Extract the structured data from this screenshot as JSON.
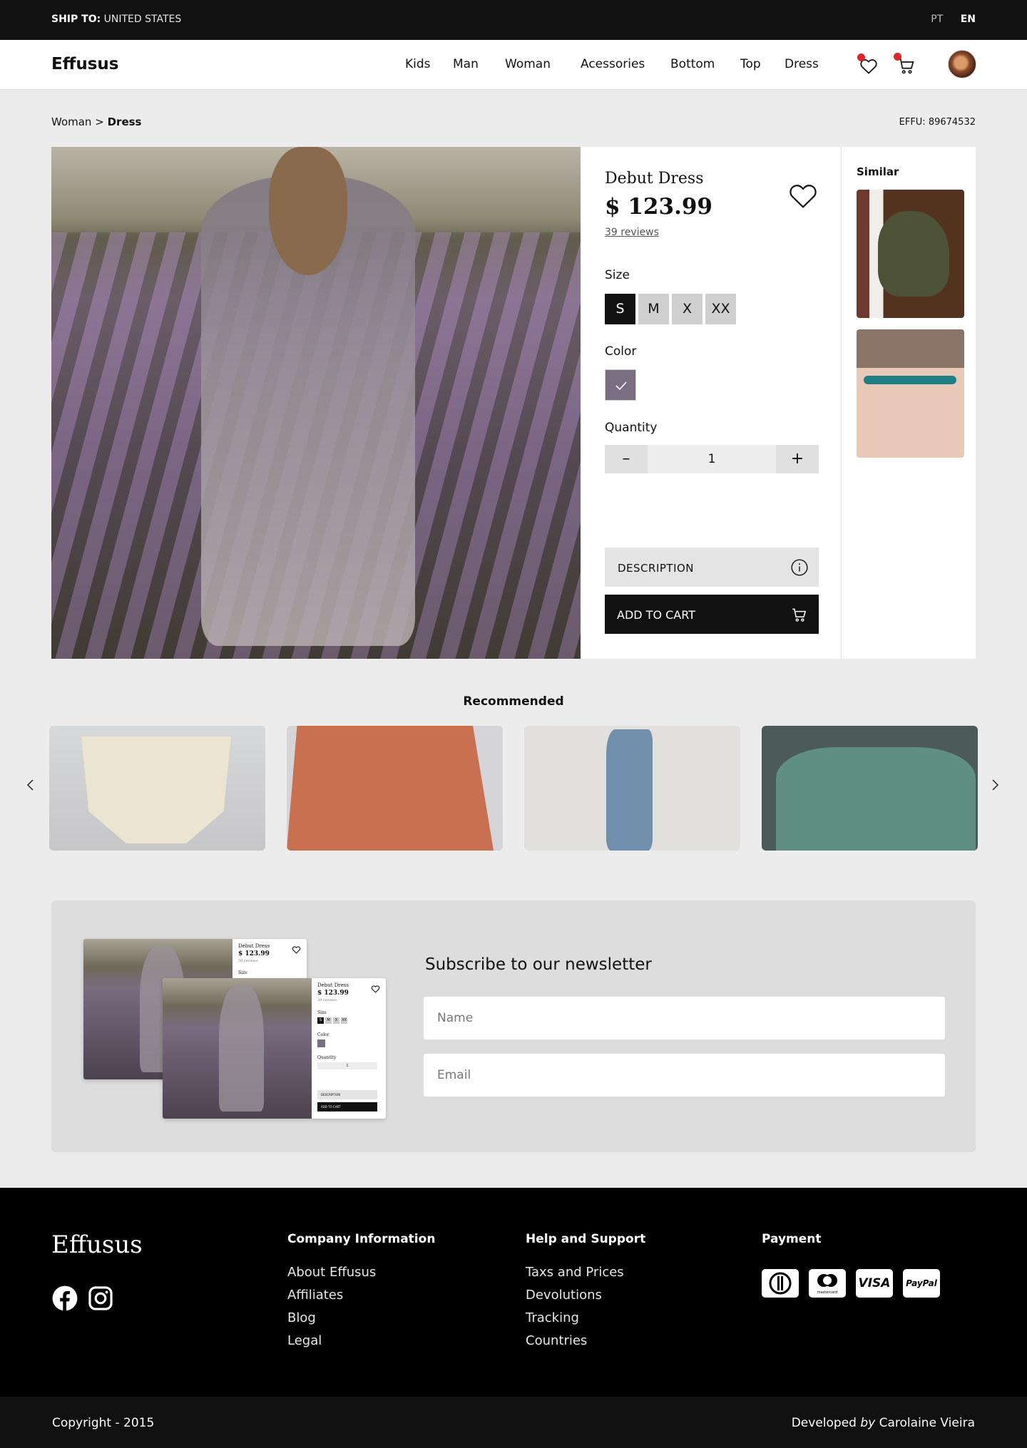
{
  "topbar": {
    "ship_label": "SHIP TO:",
    "ship_value": "UNITED STATES",
    "lang_pt": "PT",
    "lang_en": "EN",
    "active_lang": "EN"
  },
  "header": {
    "logo": "Effusus",
    "menu": [
      "Kids",
      "Man",
      "Woman",
      "Acessories",
      "Bottom",
      "Top",
      "Dress"
    ],
    "icons": {
      "wishlist": "heart-icon",
      "cart": "cart-icon",
      "badge_color": "#e0242a"
    }
  },
  "breadcrumb": {
    "parent": "Woman",
    "separator": ">",
    "current": "Dress"
  },
  "sku": "EFFU: 89674532",
  "product": {
    "title": "Debut Dress",
    "price": "$ 123.99",
    "reviews": "39 reviews",
    "size_label": "Size",
    "sizes": [
      "S",
      "M",
      "X",
      "XX"
    ],
    "selected_size": "S",
    "color_label": "Color",
    "colors": [
      "#7a6e82"
    ],
    "quantity_label": "Quantity",
    "quantity": "1",
    "description_button": "DESCRIPTION",
    "add_to_cart_button": "ADD TO CART"
  },
  "similar": {
    "title": "Similar"
  },
  "recommended": {
    "title": "Recommended"
  },
  "newsletter": {
    "title": "Subscribe to our newsletter",
    "name_placeholder": "Name",
    "email_placeholder": "Email",
    "mock": {
      "title": "Debut Dress",
      "price": "$ 123.99",
      "reviews": "39 reviews",
      "size": "Size",
      "sizes": [
        "S",
        "M",
        "X",
        "XX"
      ],
      "color": "Color",
      "quantity": "Quantity",
      "qty": "1",
      "description": "DESCRIPTION",
      "cart": "ADD TO CART"
    }
  },
  "footer": {
    "logo": "Effusus",
    "company": {
      "title": "Company Information",
      "links": [
        "About Effusus",
        "Affiliates",
        "Blog",
        "Legal"
      ]
    },
    "help": {
      "title": "Help and Support",
      "links": [
        "Taxs and Prices",
        "Devolutions",
        "Tracking",
        "Countries"
      ]
    },
    "payment": {
      "title": "Payment",
      "methods": [
        "diners-club-icon",
        "mastercard-icon",
        "visa-icon",
        "paypal-icon"
      ],
      "mastercard_text": "mastercard",
      "visa_text": "VISA",
      "paypal_text": "PayPal"
    },
    "copyright": "Copyright - 2015",
    "credit_prefix": "Developed",
    "credit_by": "by",
    "credit_name": "Carolaine Vieira"
  }
}
